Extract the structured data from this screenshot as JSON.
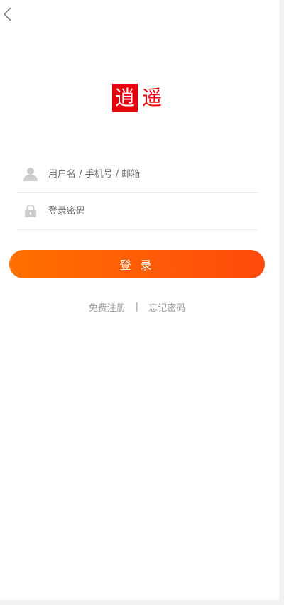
{
  "logo": {
    "char1": "逍",
    "char2": "遥"
  },
  "username": {
    "placeholder": "用户名 / 手机号 / 邮箱",
    "value": "",
    "icon": "user-icon"
  },
  "password": {
    "placeholder": "登录密码",
    "value": "",
    "icon": "lock-icon"
  },
  "login_button": {
    "label": "登 录"
  },
  "links": {
    "register": "免费注册",
    "separator": "|",
    "forgot": "忘记密码"
  },
  "colors": {
    "brand_red": "#e8000c",
    "button_gradient_start": "#ff7000",
    "button_gradient_end": "#ff4a0c",
    "link_gray": "#999999"
  }
}
